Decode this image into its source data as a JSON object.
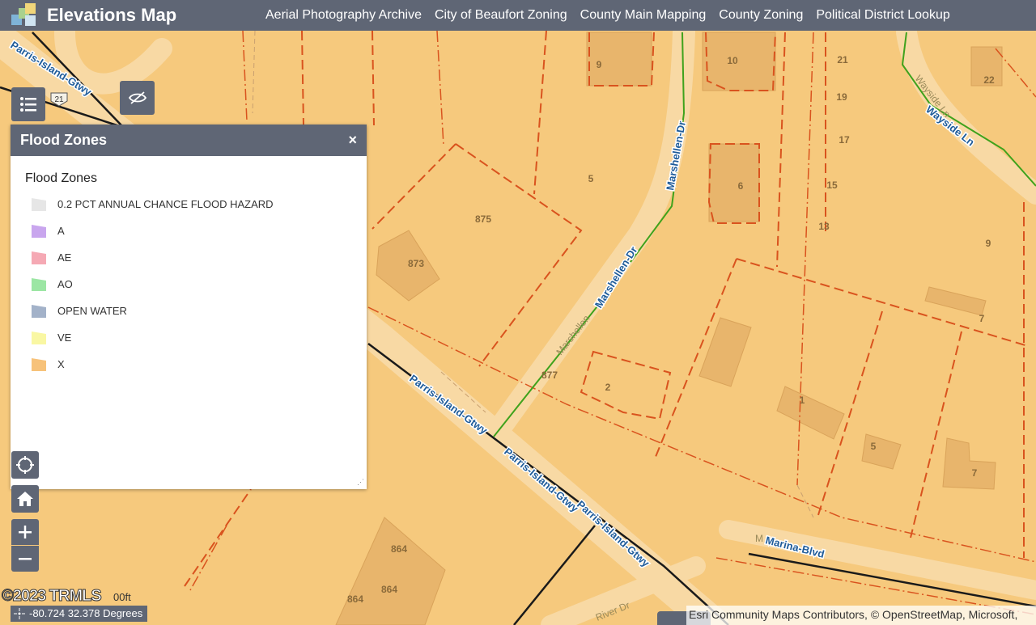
{
  "header": {
    "title": "Elevations Map",
    "nav": [
      "Aerial Photography Archive",
      "City of Beaufort Zoning",
      "County Main Mapping",
      "County Zoning",
      "Political District Lookup"
    ]
  },
  "legend_panel": {
    "title": "Flood Zones",
    "close_label": "×",
    "layer_title": "Flood Zones",
    "items": [
      {
        "label": "0.2 PCT ANNUAL CHANCE FLOOD HAZARD",
        "color": "#e6e6e6"
      },
      {
        "label": "A",
        "color": "#c9a6ee"
      },
      {
        "label": "AE",
        "color": "#f5a9b4"
      },
      {
        "label": "AO",
        "color": "#9ce6a4"
      },
      {
        "label": "OPEN WATER",
        "color": "#a3b2c9"
      },
      {
        "label": "VE",
        "color": "#f9f7a3"
      },
      {
        "label": "X",
        "color": "#f7c27a"
      }
    ]
  },
  "map": {
    "streets": {
      "parris_island": "Parris-Island-Gtwy",
      "marshellen": "Marshellen-Dr",
      "marshellen_short": "Marshellen",
      "wayside": "Wayside Ln",
      "marina": "Marina-Blvd",
      "marina_short": "M",
      "river": "River Dr",
      "route_shield": "21"
    },
    "parcel_labels": [
      "9",
      "10",
      "21",
      "22",
      "19",
      "17",
      "5",
      "6",
      "15",
      "875",
      "13",
      "9",
      "873",
      "7",
      "877",
      "2",
      "1",
      "5",
      "7",
      "864",
      "864",
      "864"
    ]
  },
  "status": {
    "coordinates": "-80.724 32.378 Degrees",
    "attribution": "Esri Community Maps Contributors, © OpenStreetMap, Microsoft,",
    "watermark": "©2023 TRMLS",
    "scale_fragment": "00ft"
  },
  "colors": {
    "header_bg": "#5f6675",
    "map_bg": "#f6c97d",
    "parcel_line": "#d9531e",
    "road_casing": "#f8d9a4"
  },
  "icons": [
    "layer-list-icon",
    "visibility-toggle-icon",
    "locate-icon",
    "home-icon",
    "zoom-in-icon",
    "zoom-out-icon",
    "close-icon"
  ]
}
